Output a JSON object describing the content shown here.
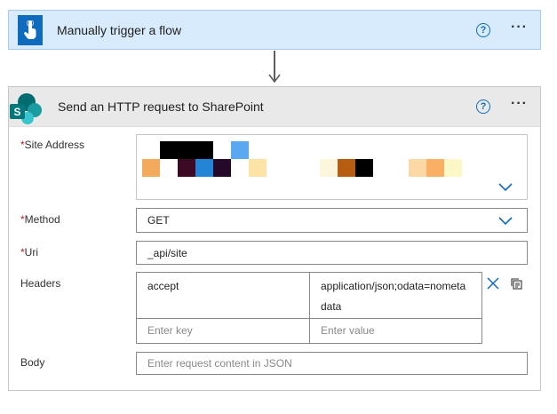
{
  "trigger": {
    "title": "Manually trigger a flow",
    "help_label": "?",
    "more_label": "···",
    "icon": "touch-hand-icon",
    "color": "#0f6cbd"
  },
  "action": {
    "title": "Send an HTTP request to SharePoint",
    "help_label": "?",
    "more_label": "···",
    "icon": "sharepoint-icon"
  },
  "fields": {
    "site_address": {
      "label": "Site Address",
      "required_mark": "*"
    },
    "method": {
      "label": "Method",
      "required_mark": "*",
      "value": "GET"
    },
    "uri": {
      "label": "Uri",
      "required_mark": "*",
      "value": "_api/site"
    },
    "headers": {
      "label": "Headers",
      "rows": [
        {
          "key": "accept",
          "value_line1": "application/json;odata=nometa",
          "value_line2": "data"
        }
      ],
      "key_placeholder": "Enter key",
      "value_placeholder": "Enter value"
    },
    "body": {
      "label": "Body",
      "placeholder": "Enter request content in JSON"
    }
  }
}
